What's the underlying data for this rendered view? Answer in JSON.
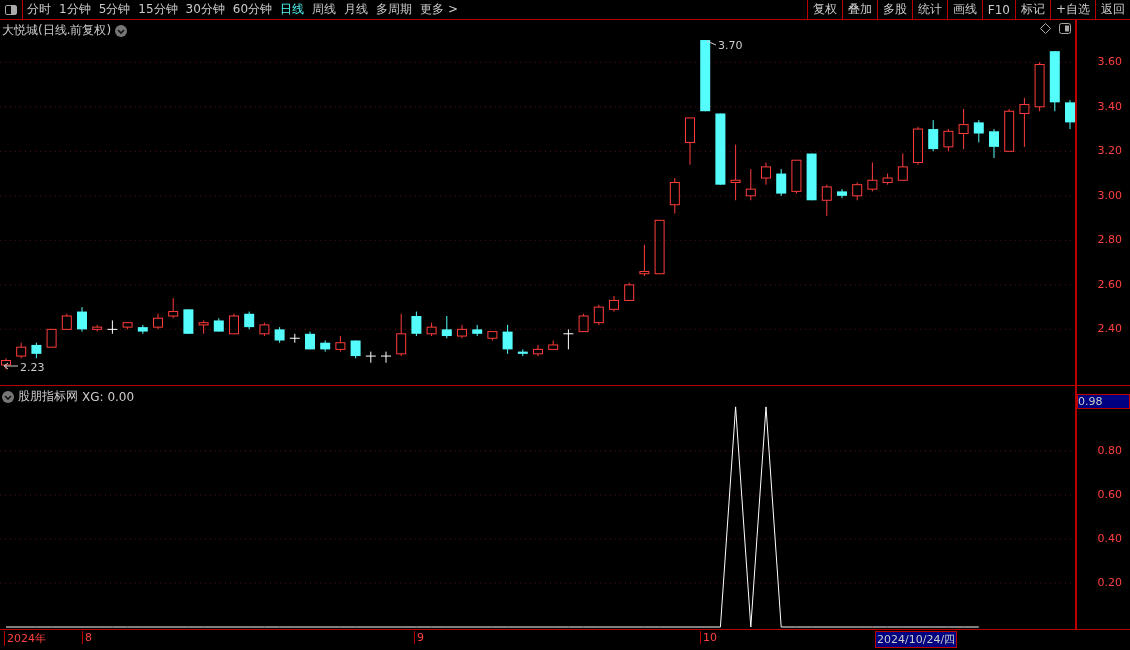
{
  "toolbar": {
    "periods": [
      {
        "label": "分时",
        "selected": false
      },
      {
        "label": "1分钟",
        "selected": false
      },
      {
        "label": "5分钟",
        "selected": false
      },
      {
        "label": "15分钟",
        "selected": false
      },
      {
        "label": "30分钟",
        "selected": false
      },
      {
        "label": "60分钟",
        "selected": false
      },
      {
        "label": "日线",
        "selected": true
      },
      {
        "label": "周线",
        "selected": false
      },
      {
        "label": "月线",
        "selected": false
      },
      {
        "label": "多周期",
        "selected": false
      },
      {
        "label": "更多 >",
        "selected": false
      }
    ],
    "buttons": [
      "复权",
      "叠加",
      "多股",
      "统计",
      "画线",
      "F10",
      "标记",
      "+自选",
      "返回"
    ]
  },
  "price_chart": {
    "title": "大悦城(日线.前复权)",
    "max_label": "3.70",
    "min_label": "2.23",
    "chart_data": {
      "type": "candlestick",
      "grid": true,
      "ylim": [
        2.15,
        3.79
      ],
      "yticks": [
        {
          "value": 3.6,
          "label": "3.60"
        },
        {
          "value": 3.4,
          "label": "3.40"
        },
        {
          "value": 3.2,
          "label": "3.20"
        },
        {
          "value": 3.0,
          "label": "3.00"
        },
        {
          "value": 2.8,
          "label": "2.80"
        },
        {
          "value": 2.6,
          "label": "2.60"
        },
        {
          "value": 2.4,
          "label": "2.40"
        }
      ],
      "ohlc": [
        [
          2.24,
          2.27,
          2.22,
          2.26
        ],
        [
          2.28,
          2.34,
          2.27,
          2.32
        ],
        [
          2.33,
          2.34,
          2.27,
          2.29
        ],
        [
          2.32,
          2.4,
          2.32,
          2.4
        ],
        [
          2.4,
          2.47,
          2.4,
          2.46
        ],
        [
          2.48,
          2.5,
          2.39,
          2.4
        ],
        [
          2.4,
          2.42,
          2.39,
          2.41
        ],
        [
          2.4,
          2.44,
          2.38,
          2.4
        ],
        [
          2.41,
          2.43,
          2.4,
          2.43
        ],
        [
          2.41,
          2.42,
          2.38,
          2.39
        ],
        [
          2.41,
          2.47,
          2.4,
          2.45
        ],
        [
          2.46,
          2.54,
          2.45,
          2.48
        ],
        [
          2.49,
          2.49,
          2.38,
          2.38
        ],
        [
          2.42,
          2.44,
          2.38,
          2.43
        ],
        [
          2.44,
          2.45,
          2.39,
          2.39
        ],
        [
          2.38,
          2.47,
          2.38,
          2.46
        ],
        [
          2.47,
          2.48,
          2.4,
          2.41
        ],
        [
          2.38,
          2.43,
          2.37,
          2.42
        ],
        [
          2.4,
          2.41,
          2.34,
          2.35
        ],
        [
          2.36,
          2.38,
          2.34,
          2.36
        ],
        [
          2.38,
          2.39,
          2.31,
          2.31
        ],
        [
          2.34,
          2.35,
          2.3,
          2.31
        ],
        [
          2.31,
          2.37,
          2.3,
          2.34
        ],
        [
          2.35,
          2.35,
          2.27,
          2.28
        ],
        [
          2.28,
          2.3,
          2.25,
          2.28
        ],
        [
          2.28,
          2.3,
          2.25,
          2.28
        ],
        [
          2.29,
          2.47,
          2.28,
          2.38
        ],
        [
          2.46,
          2.48,
          2.37,
          2.38
        ],
        [
          2.38,
          2.43,
          2.37,
          2.41
        ],
        [
          2.4,
          2.46,
          2.36,
          2.37
        ],
        [
          2.37,
          2.42,
          2.36,
          2.4
        ],
        [
          2.4,
          2.42,
          2.37,
          2.38
        ],
        [
          2.36,
          2.39,
          2.35,
          2.39
        ],
        [
          2.39,
          2.42,
          2.29,
          2.31
        ],
        [
          2.3,
          2.31,
          2.28,
          2.29
        ],
        [
          2.29,
          2.33,
          2.28,
          2.31
        ],
        [
          2.31,
          2.35,
          2.31,
          2.33
        ],
        [
          2.38,
          2.4,
          2.31,
          2.38
        ],
        [
          2.39,
          2.47,
          2.39,
          2.46
        ],
        [
          2.43,
          2.51,
          2.42,
          2.5
        ],
        [
          2.49,
          2.55,
          2.48,
          2.53
        ],
        [
          2.53,
          2.61,
          2.53,
          2.6
        ],
        [
          2.65,
          2.78,
          2.64,
          2.66
        ],
        [
          2.65,
          2.89,
          2.65,
          2.89
        ],
        [
          2.96,
          3.08,
          2.92,
          3.06
        ],
        [
          3.24,
          3.35,
          3.14,
          3.35
        ],
        [
          3.7,
          3.7,
          3.38,
          3.38
        ],
        [
          3.37,
          3.37,
          3.05,
          3.05
        ],
        [
          3.06,
          3.23,
          2.98,
          3.07
        ],
        [
          3.0,
          3.12,
          2.98,
          3.03
        ],
        [
          3.08,
          3.15,
          3.05,
          3.13
        ],
        [
          3.1,
          3.12,
          3.0,
          3.01
        ],
        [
          3.02,
          3.16,
          3.01,
          3.16
        ],
        [
          3.19,
          3.19,
          2.98,
          2.98
        ],
        [
          2.98,
          3.05,
          2.91,
          3.04
        ],
        [
          3.02,
          3.03,
          2.99,
          3.0
        ],
        [
          3.0,
          3.06,
          2.98,
          3.05
        ],
        [
          3.03,
          3.15,
          3.02,
          3.07
        ],
        [
          3.06,
          3.1,
          3.05,
          3.08
        ],
        [
          3.07,
          3.19,
          3.07,
          3.13
        ],
        [
          3.15,
          3.31,
          3.14,
          3.3
        ],
        [
          3.3,
          3.34,
          3.2,
          3.21
        ],
        [
          3.22,
          3.3,
          3.2,
          3.29
        ],
        [
          3.28,
          3.39,
          3.21,
          3.32
        ],
        [
          3.33,
          3.34,
          3.24,
          3.28
        ],
        [
          3.29,
          3.3,
          3.17,
          3.22
        ],
        [
          3.2,
          3.39,
          3.2,
          3.38
        ],
        [
          3.37,
          3.44,
          3.22,
          3.41
        ],
        [
          3.4,
          3.6,
          3.38,
          3.59
        ],
        [
          3.65,
          3.65,
          3.38,
          3.42
        ],
        [
          3.42,
          3.43,
          3.3,
          3.33
        ]
      ]
    }
  },
  "indicator": {
    "name": "股朋指标网",
    "reading": ": 0.00",
    "cursor_value": "0.98",
    "chart_data": {
      "type": "line",
      "grid": true,
      "ylim": [
        0,
        1.095
      ],
      "yticks": [
        {
          "value": 0.8,
          "label": "0.80"
        },
        {
          "value": 0.6,
          "label": "0.60"
        },
        {
          "value": 0.4,
          "label": "0.40"
        },
        {
          "value": 0.2,
          "label": "0.20"
        }
      ],
      "series": [
        {
          "name": "XG",
          "color": "#ffffff",
          "values": [
            0,
            0,
            0,
            0,
            0,
            0,
            0,
            0,
            0,
            0,
            0,
            0,
            0,
            0,
            0,
            0,
            0,
            0,
            0,
            0,
            0,
            0,
            0,
            0,
            0,
            0,
            0,
            0,
            0,
            0,
            0,
            0,
            0,
            0,
            0,
            0,
            0,
            0,
            0,
            0,
            0,
            0,
            0,
            0,
            0,
            0,
            0,
            0,
            1,
            0,
            1,
            0,
            0,
            0,
            0,
            0,
            0,
            0,
            0,
            0,
            0,
            0,
            0,
            0,
            0,
            null,
            null,
            null,
            null,
            null,
            null
          ]
        }
      ]
    }
  },
  "date_axis": {
    "labels": [
      "2024年",
      "8",
      "9",
      "10"
    ],
    "cursor_date": "2024/10/24/四"
  }
}
